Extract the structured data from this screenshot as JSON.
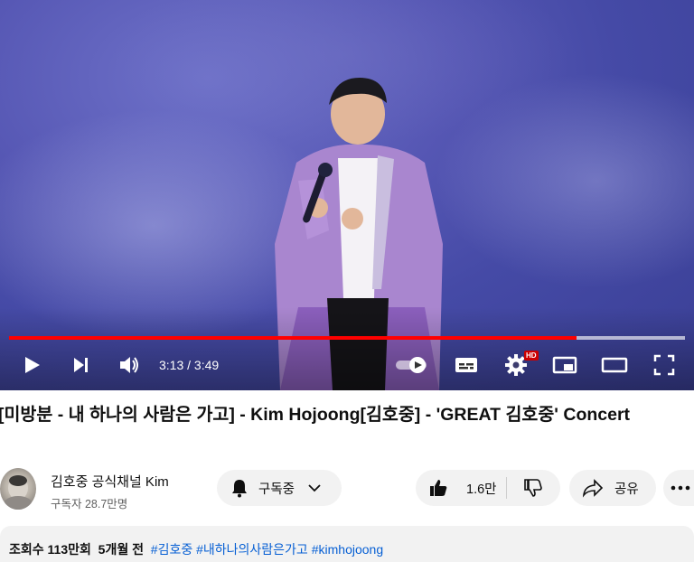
{
  "player": {
    "current_time": "3:13",
    "duration": "3:49",
    "time_display": "3:13 / 3:49",
    "progress_fraction": 0.84,
    "buffered_fraction": 1.0,
    "hd_badge": "HD",
    "autoplay_on": true,
    "colors": {
      "progress": "#ff0000",
      "hd_badge": "#cc0000"
    },
    "icons": [
      "play-icon",
      "next-icon",
      "volume-icon",
      "autoplay-toggle-icon",
      "subtitles-icon",
      "settings-icon",
      "miniplayer-icon",
      "theater-mode-icon",
      "fullscreen-icon"
    ]
  },
  "video": {
    "title": "[미방분 - 내 하나의 사람은 가고] - Kim Hojoong[김호중] - 'GREAT 김호중' Concert"
  },
  "channel": {
    "name": "김호중 공식채널 Kim",
    "subscribers": "구독자 28.7만명",
    "subscribe_label": "구독중"
  },
  "actions": {
    "likes": "1.6만",
    "share_label": "공유"
  },
  "description": {
    "views": "조회수 113만회",
    "age": "5개월 전",
    "hashtags": [
      "#김호중",
      "#내하나의사람은가고",
      "#kimhojoong"
    ]
  }
}
